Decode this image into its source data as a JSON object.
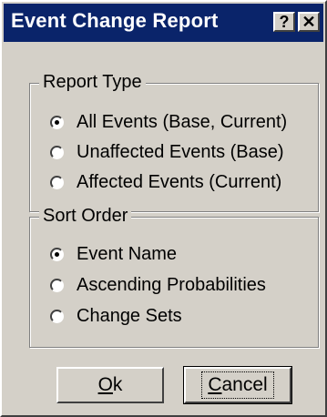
{
  "window": {
    "title": "Event Change Report",
    "help_label": "?",
    "close_label": "✕"
  },
  "report_type": {
    "label": "Report Type",
    "options": [
      {
        "label": "All Events (Base, Current)",
        "selected": true
      },
      {
        "label": "Unaffected Events (Base)",
        "selected": false
      },
      {
        "label": "Affected Events (Current)",
        "selected": false
      }
    ]
  },
  "sort_order": {
    "label": "Sort Order",
    "options": [
      {
        "label": "Event Name",
        "selected": true
      },
      {
        "label": "Ascending Probabilities",
        "selected": false
      },
      {
        "label": "Change Sets",
        "selected": false
      }
    ]
  },
  "buttons": {
    "ok_mnemonic": "O",
    "ok_rest": "k",
    "cancel_mnemonic": "C",
    "cancel_rest": "ancel"
  }
}
